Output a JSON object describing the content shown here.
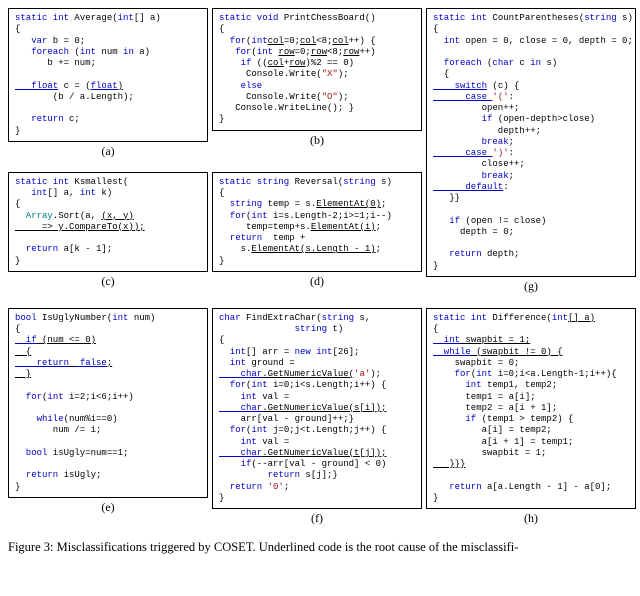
{
  "panels": {
    "a": {
      "label": "(a)",
      "l1": "static int",
      "l1b": " Average(",
      "l1c": "int",
      "l1d": "[] a)",
      "l2": "{",
      "l3a": "   var",
      "l3b": " b = 0;",
      "l4a": "   foreach",
      "l4b": " (",
      "l4c": "int",
      "l4d": " num ",
      "l4e": "in",
      "l4f": " a)",
      "l5": "      b += num;",
      "l6": "",
      "l7a": "   float",
      "l7b": " c = (",
      "l7c": "float",
      "l7d": ")",
      "l8": "       (b / a.Length);",
      "l9": "",
      "l10a": "   return",
      "l10b": " c;",
      "l11": "}"
    },
    "b": {
      "label": "(b)",
      "l1": "static void",
      "l1b": " PrintChessBoard()",
      "l2": "{",
      "l3a": "  for",
      "l3b": "(",
      "l3c": "int",
      "l3d": " col=0;col<8;col++) {",
      "l4a": "   for",
      "l4b": "(",
      "l4c": "int",
      "l4d": " row=0;row<8;row++)",
      "l5a": "    if",
      "l5b": " ((col+row)%2 == 0)",
      "l6a": "     Console.Write(",
      "l6b": "\"X\"",
      "l6c": ");",
      "l7a": "    else",
      "l8a": "     Console.Write(",
      "l8b": "\"O\"",
      "l8c": ");",
      "l9": "   Console.WriteLine(); }",
      "l10": "}"
    },
    "c": {
      "label": "(c)",
      "l1": "static int",
      "l1b": " Ksmallest(",
      "l2a": "   int",
      "l2b": "[] a, ",
      "l2c": "int",
      "l2d": " k)",
      "l3": "{",
      "l4a": "  Array",
      "l4b": ".Sort(a, (x, y)",
      "l5": "     => y.CompareTo(x));",
      "l6": "",
      "l7a": "  return",
      "l7b": " a[k - 1];",
      "l8": "}"
    },
    "d": {
      "label": "(d)",
      "l1": "static string",
      "l1b": " Reversal(",
      "l1c": "string",
      "l1d": " s)",
      "l2": "{",
      "l3a": "  string",
      "l3b": " temp = s.ElementAt(0);",
      "l4a": "  for",
      "l4b": "(",
      "l4c": "int",
      "l4d": " i=s.Length-2;i>=1;i--)",
      "l5": "     temp=temp+s.ElementAt(i);",
      "l6a": "  return",
      "l6b": "  temp +",
      "l7": "    s.ElementAt(s.Length - 1);",
      "l8": "}"
    },
    "e": {
      "label": "(e)",
      "l1": "bool",
      "l1b": " IsUglyNumber(",
      "l1c": "int",
      "l1d": " num)",
      "l2": "{",
      "l3a": "  if",
      "l3b": " (num <= 0)",
      "l4": "  {",
      "l5a": "    return",
      "l5b": " false",
      "l5c": ";",
      "l6": "  }",
      "l7": "",
      "l8a": "  for",
      "l8b": "(",
      "l8c": "int",
      "l8d": " i=2;i<6;i++)",
      "l9": "",
      "l10a": "    while",
      "l10b": "(num%i==0)",
      "l11": "       num /= i;",
      "l12": "",
      "l13a": "  bool",
      "l13b": " isUgly=num==1;",
      "l14": "",
      "l15a": "  return",
      "l15b": " isUgly;",
      "l16": "}"
    },
    "f": {
      "label": "(f)",
      "l1": "char",
      "l1b": " FindExtraChar(",
      "l1c": "string",
      "l1d": " s,",
      "l2a": "              string",
      "l2b": " t)",
      "l3": "{",
      "l4a": "  int",
      "l4b": "[] arr = ",
      "l4c": "new int",
      "l4d": "[26];",
      "l5a": "  int",
      "l5b": " ground =",
      "l6a": "    char",
      "l6b": ".GetNumericValue(",
      "l6c": "'a'",
      "l6d": ");",
      "l7a": "  for",
      "l7b": "(",
      "l7c": "int",
      "l7d": " i=0;i<s.Length;i++) {",
      "l8a": "    int",
      "l8b": " val =",
      "l9a": "    char",
      "l9b": ".GetNumericValue(s[i]);",
      "l10": "    arr[val - ground]++;}",
      "l11a": "  for",
      "l11b": "(",
      "l11c": "int",
      "l11d": " j=0;j<t.Length;j++) {",
      "l12a": "    int",
      "l12b": " val =",
      "l13a": "    char",
      "l13b": ".GetNumericValue(t[j]);",
      "l14a": "    if",
      "l14b": "(--arr[val - ground] < 0)",
      "l15a": "         return",
      "l15b": " s[j];}",
      "l16a": "  return ",
      "l16b": "'0'",
      "l16c": ";",
      "l17": "}"
    },
    "g": {
      "label": "(g)",
      "l1": "static int",
      "l1b": " CountParentheses(",
      "l1c": "string",
      "l1d": " s)",
      "l2": "{",
      "l3a": "  int",
      "l3b": " open = 0, close = 0, depth = 0;",
      "l4": "",
      "l5a": "  foreach",
      "l5b": " (",
      "l5c": "char",
      "l5d": " c ",
      "l5e": "in",
      "l5f": " s)",
      "l6": "  {",
      "l7a": "    switch",
      "l7b": " (c) {",
      "l8a": "      case ",
      "l8b": "'('",
      "l8c": ":",
      "l9": "         open++;",
      "l10a": "         if",
      "l10b": " (open-depth>close)",
      "l11": "            depth++;",
      "l12a": "         break",
      "l12b": ";",
      "l13a": "      case ",
      "l13b": "')'",
      "l13c": ":",
      "l14": "         close++;",
      "l15a": "         break",
      "l15b": ";",
      "l16a": "      default",
      "l16b": ":",
      "l17": "   }}",
      "l18": "",
      "l19a": "   if",
      "l19b": " (open != close)",
      "l20": "     depth = 0;",
      "l21": "",
      "l22a": "   return",
      "l22b": " depth;",
      "l23": "}"
    },
    "h": {
      "label": "(h)",
      "l1": "static int",
      "l1b": " Difference(",
      "l1c": "int",
      "l1d": "[] a)",
      "l2": "{",
      "l3a": "  int",
      "l3b": " swapbit = 1;",
      "l4a": "  while",
      "l4b": " (swapbit != 0) {",
      "l5": "    swapbit = 0;",
      "l6a": "    for",
      "l6b": "(",
      "l6c": "int",
      "l6d": " i=0;i<a.Length-1;i++){",
      "l7a": "      int",
      "l7b": " temp1, temp2;",
      "l8": "      temp1 = a[i];",
      "l9": "      temp2 = a[i + 1];",
      "l10a": "      if",
      "l10b": " (temp1 > temp2) {",
      "l11": "         a[i] = temp2;",
      "l12": "         a[i + 1] = temp1;",
      "l13": "         swapbit = 1;",
      "l14": "   }}}",
      "l15": "",
      "l16a": "   return",
      "l16b": " a[a.Length - 1] - a[0];",
      "l17": "}"
    }
  },
  "caption": "Figure 3: Misclassifications triggered by COSET. Underlined code is the root cause of the misclassifi-"
}
